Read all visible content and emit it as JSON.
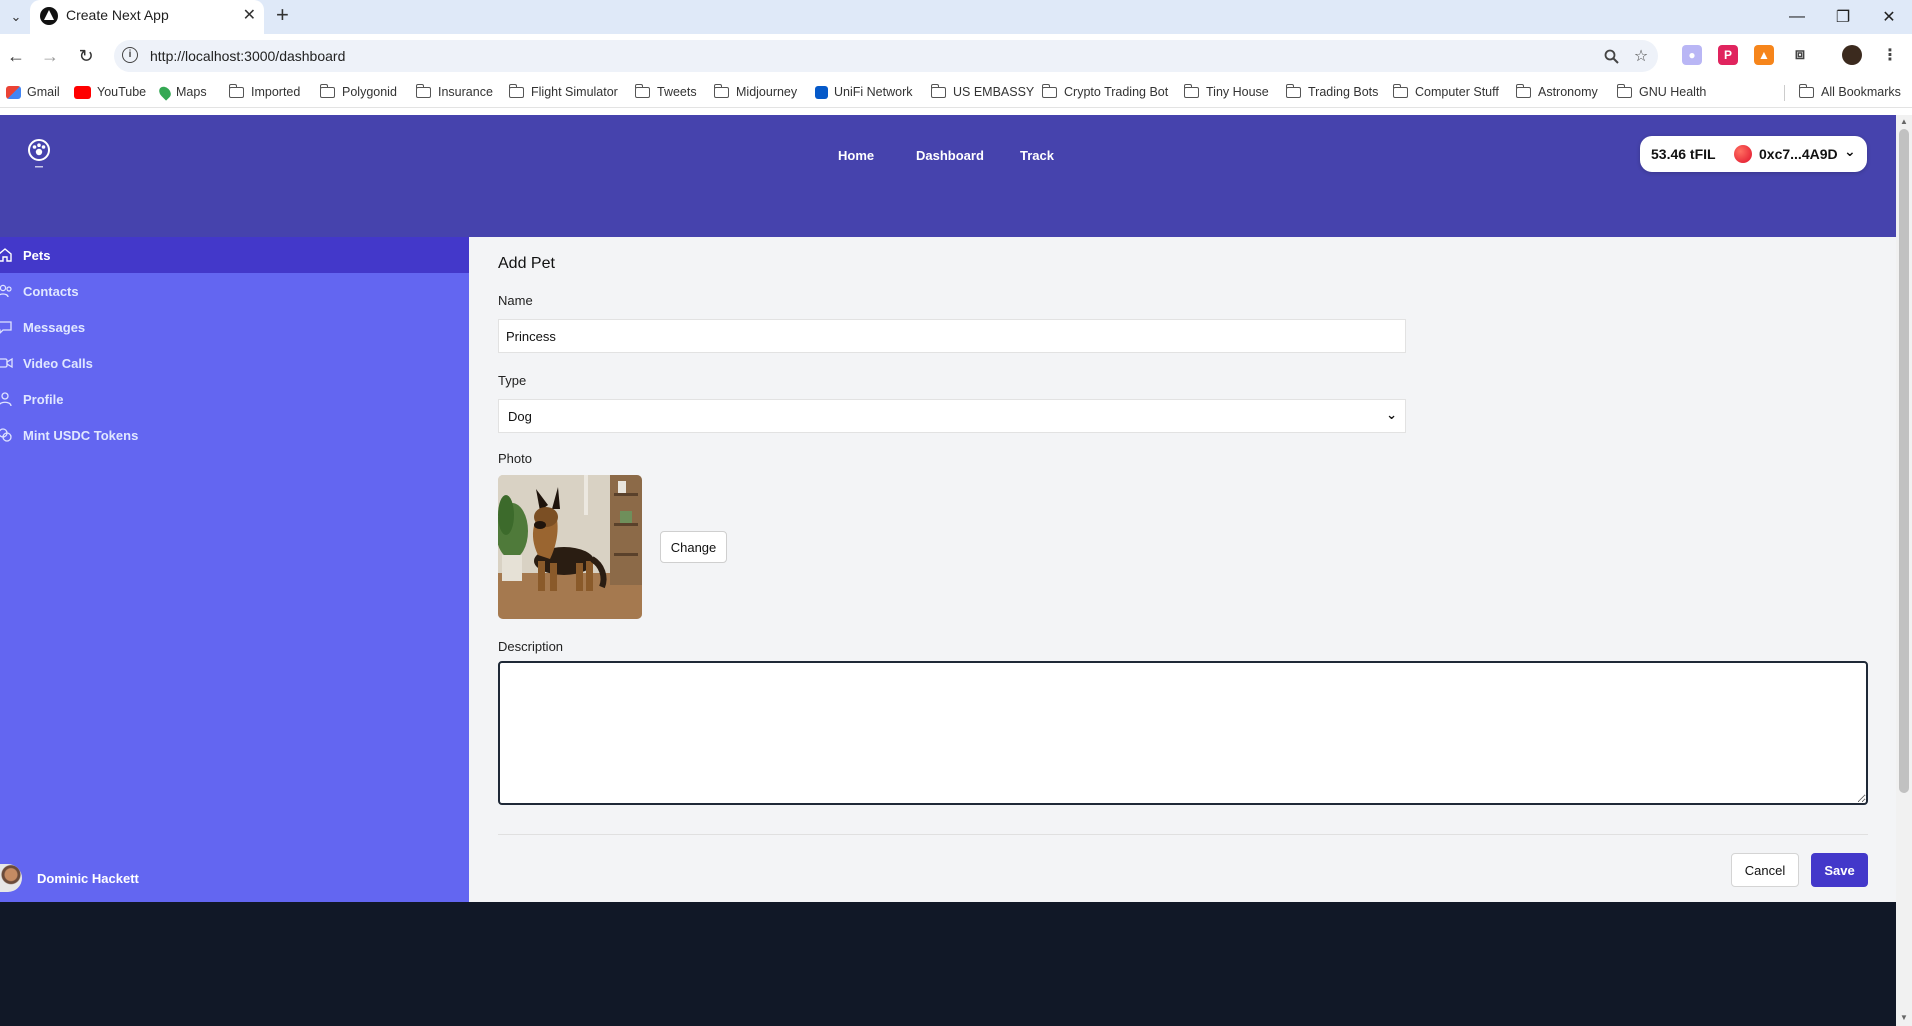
{
  "browser": {
    "tab_title": "Create Next App",
    "url": "http://localhost:3000/dashboard",
    "new_tab": "+",
    "bookmarks": [
      "Gmail",
      "YouTube",
      "Maps",
      "Imported",
      "Polygonid",
      "Insurance",
      "Flight Simulator",
      "Tweets",
      "Midjourney",
      "UniFi Network",
      "US EMBASSY",
      "Crypto Trading Bot",
      "Tiny House",
      "Trading Bots",
      "Computer Stuff",
      "Astronomy",
      "GNU Health"
    ],
    "all_bookmarks": "All Bookmarks"
  },
  "header": {
    "nav": [
      "Home",
      "Dashboard",
      "Track"
    ],
    "wallet_balance": "53.46 tFIL",
    "wallet_address": "0xc7...4A9D"
  },
  "sidebar": {
    "items": [
      {
        "label": "Pets",
        "icon": "home-icon",
        "active": true
      },
      {
        "label": "Contacts",
        "icon": "users-icon",
        "active": false
      },
      {
        "label": "Messages",
        "icon": "chat-icon",
        "active": false
      },
      {
        "label": "Video Calls",
        "icon": "video-icon",
        "active": false
      },
      {
        "label": "Profile",
        "icon": "user-icon",
        "active": false
      },
      {
        "label": "Mint USDC Tokens",
        "icon": "coins-icon",
        "active": false
      }
    ],
    "user_name": "Dominic Hackett"
  },
  "form": {
    "title": "Add Pet",
    "name_label": "Name",
    "name_value": "Princess",
    "type_label": "Type",
    "type_value": "Dog",
    "photo_label": "Photo",
    "change_label": "Change",
    "description_label": "Description",
    "description_value": "",
    "cancel_label": "Cancel",
    "save_label": "Save"
  },
  "colors": {
    "header_bg": "#4643ad",
    "sidebar_bg": "#6366f1",
    "sidebar_active": "#4338ca",
    "primary_button": "#4338ca",
    "footer_bg": "#111827"
  }
}
